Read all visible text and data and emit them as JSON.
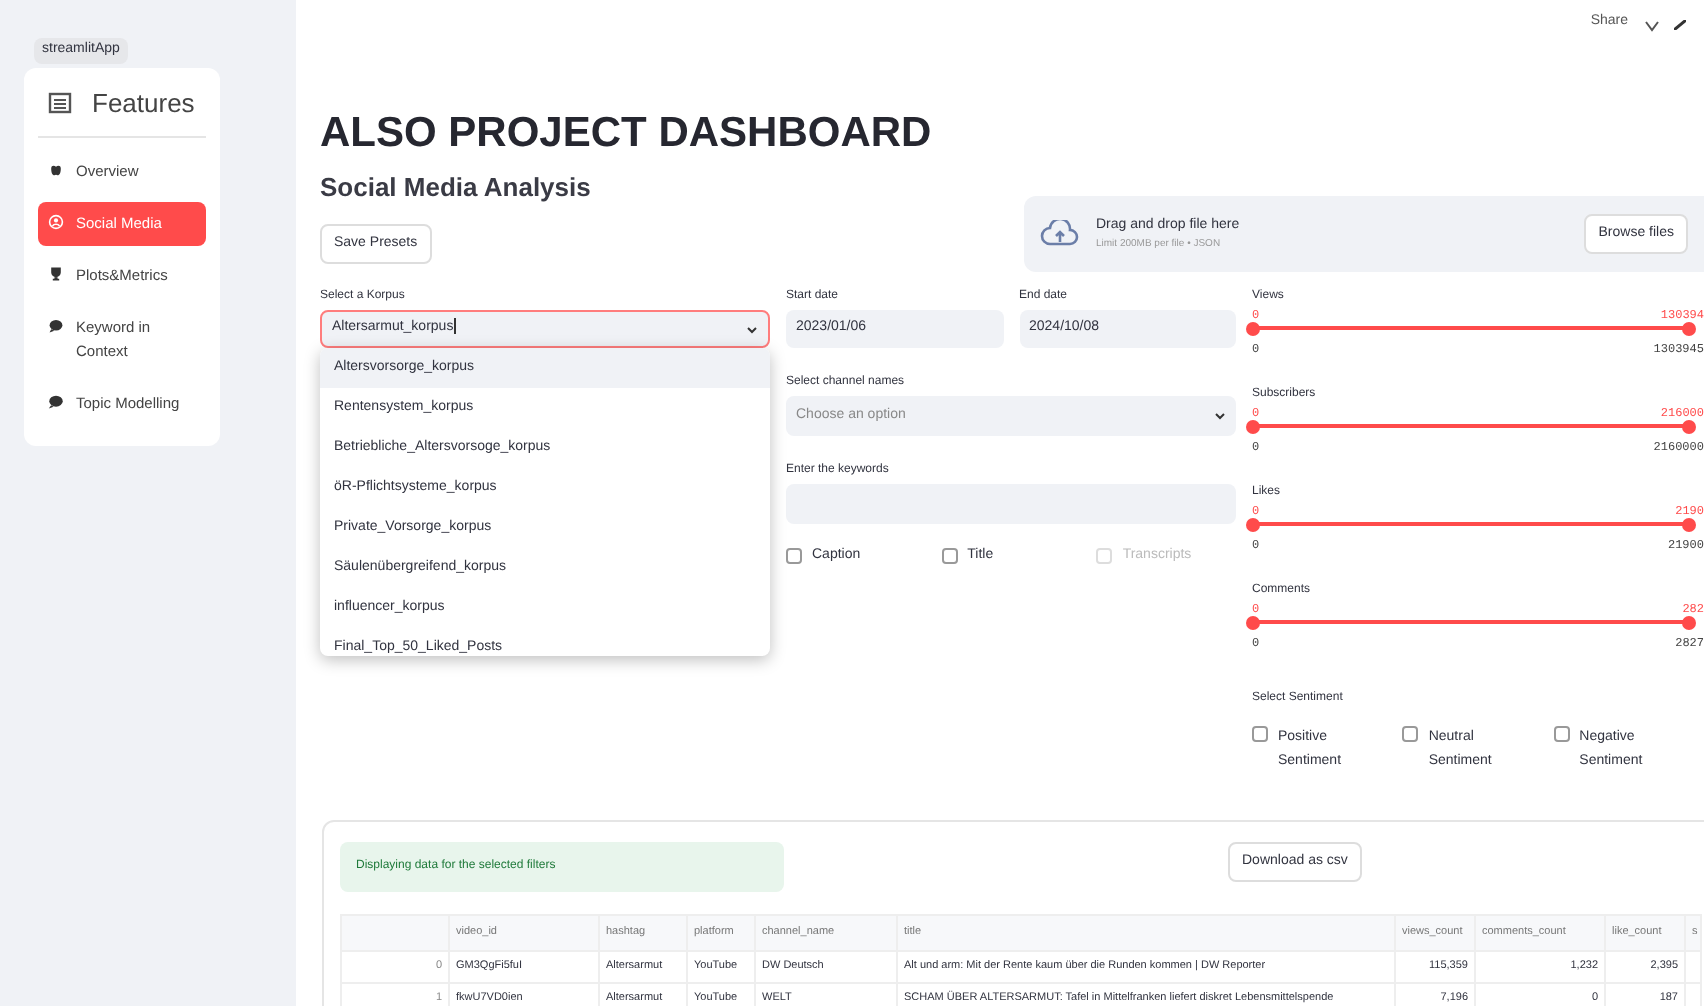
{
  "app_badge": "streamlitApp",
  "toolbar": {
    "share": "Share"
  },
  "sidebar": {
    "title": "Features",
    "items": [
      {
        "label": "Overview",
        "kind": "apple",
        "selected": false
      },
      {
        "label": "Social Media",
        "kind": "person",
        "selected": true
      },
      {
        "label": "Plots&Metrics",
        "kind": "trophy",
        "selected": false
      },
      {
        "label": "Keyword in Context",
        "kind": "chat",
        "selected": false
      },
      {
        "label": "Topic Modelling",
        "kind": "bubble",
        "selected": false
      }
    ]
  },
  "title": "ALSO PROJECT DASHBOARD",
  "subtitle": "Social Media Analysis",
  "save_button": "Save Presets",
  "uploader": {
    "title": "Drag and drop file here",
    "hint": "Limit 200MB per file • JSON",
    "button": "Browse files"
  },
  "korpus": {
    "label": "Select a Korpus",
    "value": "Altersarmut_korpus",
    "expanded": true,
    "options": [
      {
        "label": "Altersvorsorge_korpus",
        "selected": true
      },
      {
        "label": "Rentensystem_korpus",
        "selected": false
      },
      {
        "label": "Betriebliche_Altersvorsoge_korpus",
        "selected": false
      },
      {
        "label": "öR-Pflichtsysteme_korpus",
        "selected": false
      },
      {
        "label": "Private_Vorsorge_korpus",
        "selected": false
      },
      {
        "label": "Säulenübergreifend_korpus",
        "selected": false
      },
      {
        "label": "influencer_korpus",
        "selected": false
      },
      {
        "label": "Final_Top_50_Liked_Posts",
        "selected": false
      }
    ]
  },
  "start_date": {
    "label": "Start date",
    "value": "2023/01/06"
  },
  "end_date": {
    "label": "End date",
    "value": "2024/10/08"
  },
  "channels": {
    "label": "Select channel names",
    "placeholder": "Choose an option"
  },
  "keywords": {
    "label": "Enter the keywords"
  },
  "search_in": [
    {
      "label": "Caption",
      "checked": false,
      "disabled": false
    },
    {
      "label": "Title",
      "checked": false,
      "disabled": false
    },
    {
      "label": "Transcripts",
      "checked": false,
      "disabled": true
    }
  ],
  "sliders": [
    {
      "label": "Views",
      "low": "0",
      "high": "130394",
      "min": "0",
      "max": "1303945",
      "level": 1
    },
    {
      "label": "Subscribers",
      "low": "0",
      "high": "216000",
      "min": "0",
      "max": "2160000",
      "level": 1
    },
    {
      "label": "Likes",
      "low": "0",
      "high": "2190",
      "min": "0",
      "max": "21900",
      "level": 1
    },
    {
      "label": "Comments",
      "low": "0",
      "high": "282",
      "min": "0",
      "max": "2827",
      "level": 1
    }
  ],
  "sentiment": {
    "label": "Select Sentiment",
    "options": [
      {
        "label": "Positive Sentiment",
        "checked": false
      },
      {
        "label": "Neutral Sentiment",
        "checked": false
      },
      {
        "label": "Negative Sentiment",
        "checked": false
      }
    ]
  },
  "alert": "Displaying data for the selected filters",
  "download_button": "Download as csv",
  "table": {
    "columns": [
      "",
      "video_id",
      "hashtag",
      "platform",
      "channel_name",
      "title",
      "views_count",
      "comments_count",
      "like_count",
      "s"
    ],
    "rows": [
      [
        "0",
        "GM3QgFi5fuI",
        "Altersarmut",
        "YouTube",
        "DW Deutsch",
        "Alt und arm: Mit der Rente kaum über die Runden kommen | DW Reporter",
        "115,359",
        "1,232",
        "2,395"
      ],
      [
        "1",
        "fkwU7VD0ien",
        "Altersarmut",
        "YouTube",
        "WELT",
        "SCHAM ÜBER ALTERSARMUT: Tafel in Mittelfranken liefert diskret Lebensmittelspende",
        "7,196",
        "0",
        "187"
      ]
    ]
  }
}
